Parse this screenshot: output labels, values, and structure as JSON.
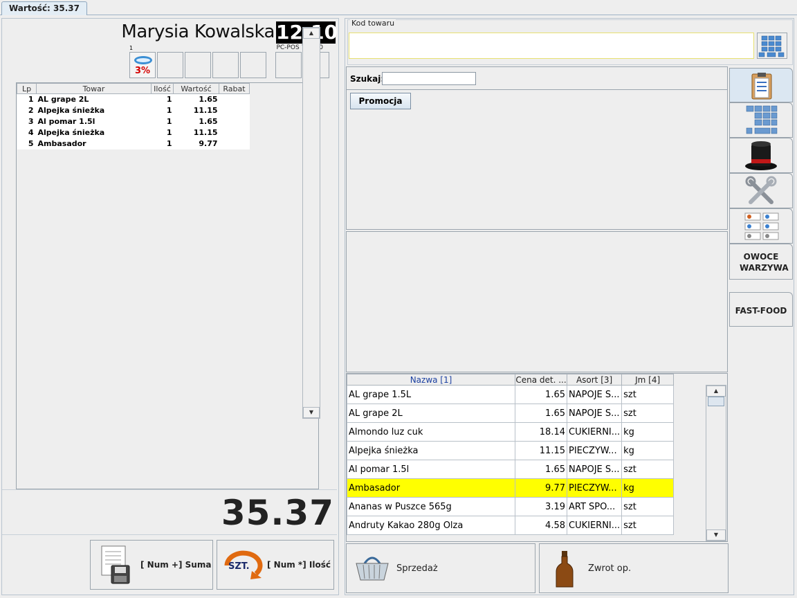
{
  "window": {
    "tab_title": "Wartość: 35.37"
  },
  "header": {
    "cashier": "Marysia Kowalska",
    "clock": "12:10",
    "version": "PC-POS 7.1.3.0",
    "slot_index": "1",
    "discount_label": "3%"
  },
  "cart": {
    "columns": [
      "Lp",
      "Towar",
      "Ilość",
      "Wartość",
      "Rabat"
    ],
    "rows": [
      {
        "lp": "1",
        "name": "AL grape 2L",
        "qty": "1",
        "value": "1.65",
        "discount": ""
      },
      {
        "lp": "2",
        "name": "Alpejka śnieżka",
        "qty": "1",
        "value": "11.15",
        "discount": ""
      },
      {
        "lp": "3",
        "name": "Al pomar 1.5l",
        "qty": "1",
        "value": "1.65",
        "discount": ""
      },
      {
        "lp": "4",
        "name": "Alpejka śnieżka",
        "qty": "1",
        "value": "11.15",
        "discount": ""
      },
      {
        "lp": "5",
        "name": "Ambasador",
        "qty": "1",
        "value": "9.77",
        "discount": ""
      }
    ]
  },
  "total": "35.37",
  "buttons": {
    "suma": "[ Num +] Suma",
    "ilosc": "[ Num *] Ilość",
    "szt_badge": "SZT.",
    "sprzedaz": "Sprzedaż",
    "zwrot": "Zwrot op."
  },
  "code": {
    "legend": "Kod towaru",
    "value": ""
  },
  "search": {
    "label": "Szukaj:",
    "value": ""
  },
  "promo_button": "Promocja",
  "products": {
    "columns": [
      "Nazwa [1]",
      "Cena det. ...",
      "Asort [3]",
      "Jm [4]"
    ],
    "rows": [
      {
        "name": "AL grape 1.5L",
        "price": "1.65",
        "asort": "NAPOJE S...",
        "unit": "szt",
        "selected": false
      },
      {
        "name": "AL grape 2L",
        "price": "1.65",
        "asort": "NAPOJE S...",
        "unit": "szt",
        "selected": false
      },
      {
        "name": "Almondo luz cuk",
        "price": "18.14",
        "asort": "CUKIERNI...",
        "unit": "kg",
        "selected": false
      },
      {
        "name": "Alpejka śnieżka",
        "price": "11.15",
        "asort": "PIECZYW...",
        "unit": "kg",
        "selected": false
      },
      {
        "name": "Al pomar 1.5l",
        "price": "1.65",
        "asort": "NAPOJE S...",
        "unit": "szt",
        "selected": false
      },
      {
        "name": "Ambasador",
        "price": "9.77",
        "asort": "PIECZYW...",
        "unit": "kg",
        "selected": true
      },
      {
        "name": "Ananas w Puszce 565g",
        "price": "3.19",
        "asort": "ART SPO...",
        "unit": "szt",
        "selected": false
      },
      {
        "name": "Andruty Kakao 280g Olza",
        "price": "4.58",
        "asort": "CUKIERNI...",
        "unit": "szt",
        "selected": false
      }
    ]
  },
  "side_tabs": [
    {
      "id": "clipboard",
      "icon": "clipboard-icon",
      "label": ""
    },
    {
      "id": "keypad",
      "icon": "keypad-icon",
      "label": ""
    },
    {
      "id": "hat",
      "icon": "top-hat-icon",
      "label": ""
    },
    {
      "id": "tools",
      "icon": "wrench-tools-icon",
      "label": ""
    },
    {
      "id": "payments",
      "icon": "payment-methods-icon",
      "label": ""
    },
    {
      "id": "owoce",
      "icon": "",
      "label": "OWOCE WARZYWA"
    },
    {
      "id": "fastfood",
      "icon": "",
      "label": "FAST-FOOD"
    }
  ],
  "colors": {
    "selected_row": "#ffff00",
    "clock_bg": "#000000",
    "discount_text": "#d40000"
  }
}
